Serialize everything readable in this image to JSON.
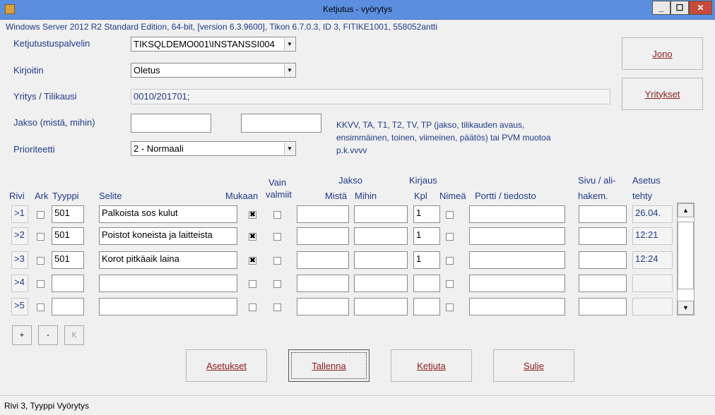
{
  "window": {
    "title": "Ketjutus - vyörytys"
  },
  "info_line": "Windows Server 2012 R2 Standard Edition, 64-bit, [version 6.3.9600], Tikon 6.7.0.3, ID 3, FITIKE1001, 558052antti",
  "form": {
    "server_label": "Ketjutustuspalvelin",
    "server_value": "TIKSQLDEMO001\\INSTANSSI004",
    "printer_label": "Kirjoitin",
    "printer_value": "Oletus",
    "company_label": "Yritys / Tilikausi",
    "company_value": "0010/201701;",
    "period_label": "Jakso (mistä, mihin)",
    "period_from": "",
    "period_to": "",
    "period_hint_1": "KKVV, TA, T1, T2, TV, TP (jakso, tilikauden avaus,",
    "period_hint_2": "ensimmäinen, toinen, viimeinen, päätös)  tai PVM muotoa",
    "period_hint_3": "p.k.vvvv",
    "priority_label": "Prioriteetti",
    "priority_value": "2 - Normaali"
  },
  "side_buttons": {
    "queue": "Jono",
    "companies": "Yritykset"
  },
  "table": {
    "headers": {
      "rivi": "Rivi",
      "ark": "Ark",
      "tyyppi": "Tyyppi",
      "selite": "Selite",
      "mukaan": "Mukaan",
      "vain_1": "Vain",
      "vain_2": "valmiit",
      "jakso": "Jakso",
      "mista": "Mistä",
      "mihin": "Mihin",
      "kirjaus": "Kirjaus",
      "kpl": "Kpl",
      "nimea": "Nimeä",
      "portti": "Portti / tiedosto",
      "sivu_1": "Sivu / ali-",
      "sivu_2": "hakem.",
      "asetus_1": "Asetus",
      "asetus_2": "tehty"
    },
    "rows": [
      {
        "rivi": ">1",
        "tyyppi": "501",
        "selite": "Palkoista sos kulut",
        "mukaan": "✖",
        "kpl": "1",
        "asetus": "26.04."
      },
      {
        "rivi": ">2",
        "tyyppi": "501",
        "selite": "Poistot koneista ja laitteista",
        "mukaan": "✖",
        "kpl": "1",
        "asetus": "12:21"
      },
      {
        "rivi": ">3",
        "tyyppi": "501",
        "selite": "Korot pitkäaik laina",
        "mukaan": "✖",
        "kpl": "1",
        "asetus": "12:24"
      },
      {
        "rivi": ">4",
        "tyyppi": "",
        "selite": "",
        "mukaan": "",
        "kpl": "",
        "asetus": ""
      },
      {
        "rivi": ">5",
        "tyyppi": "",
        "selite": "",
        "mukaan": "",
        "kpl": "",
        "asetus": ""
      }
    ]
  },
  "row_buttons": {
    "add": "+",
    "remove": "-",
    "k": "K"
  },
  "actions": {
    "settings": "Asetukset",
    "save": "Tallenna",
    "chain": "Ketjuta",
    "close": "Sulje"
  },
  "status": "Rivi 3, Tyyppi Vyörytys",
  "colors": {
    "titlebar": "#5b8ede",
    "label": "#1f3a8a",
    "button_text": "#8b1a1a",
    "close_button": "#c74a3a"
  }
}
